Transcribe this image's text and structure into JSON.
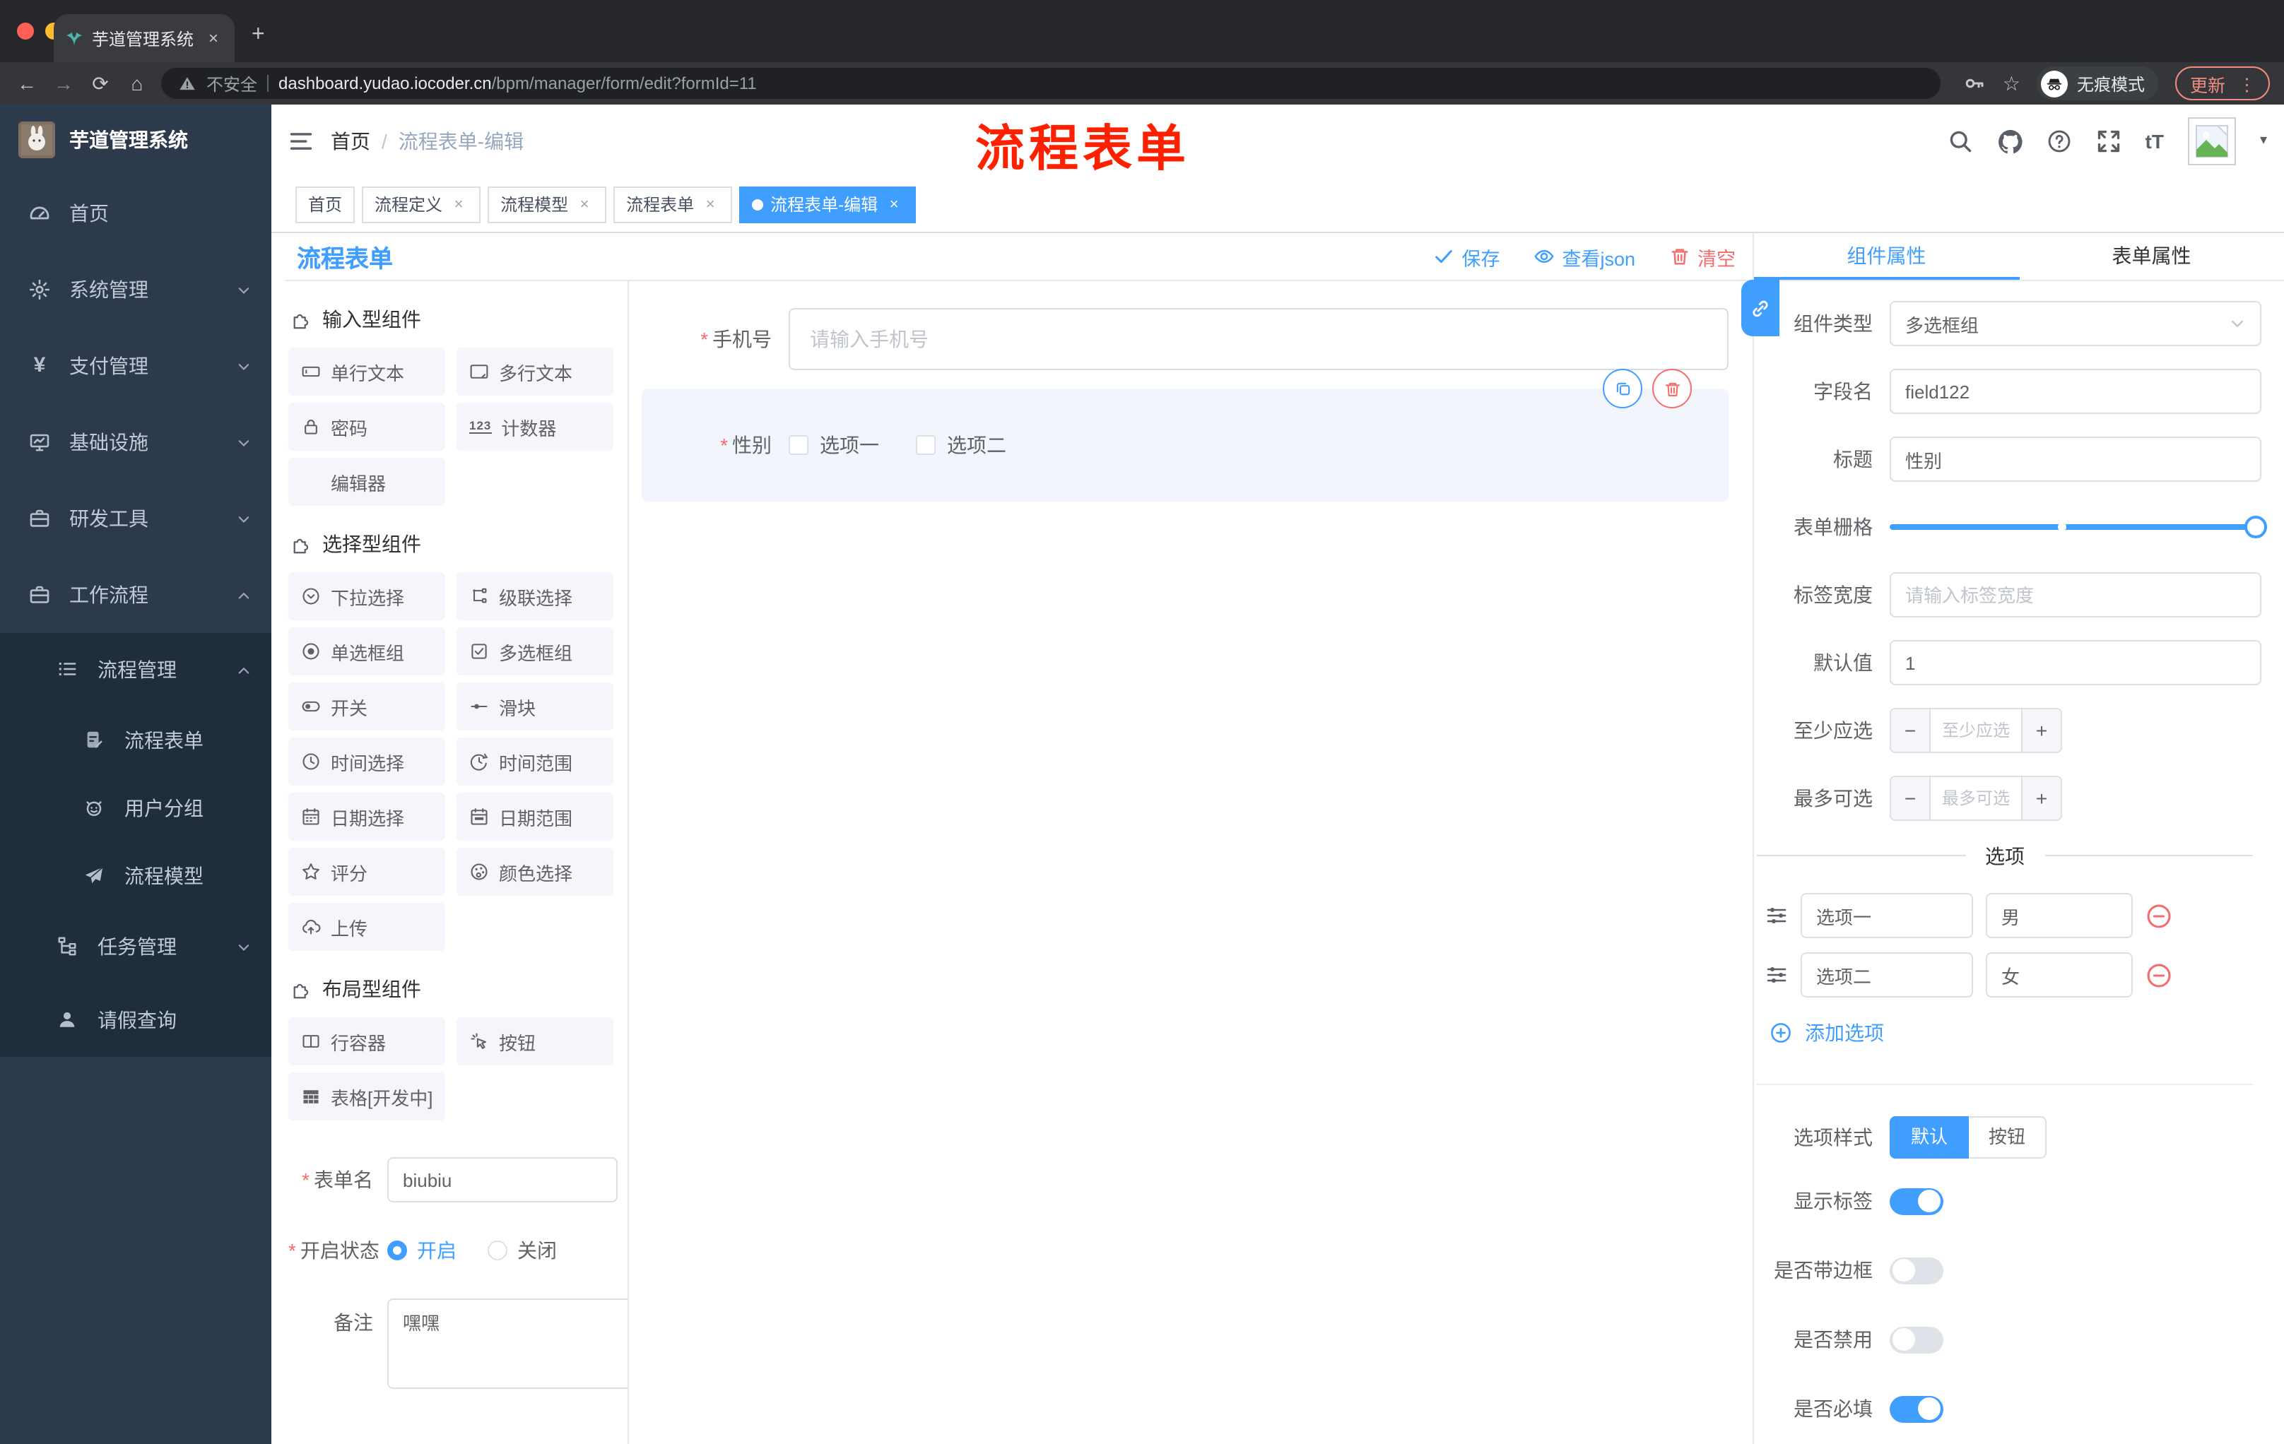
{
  "glyphs": {
    "close": "×",
    "plus": "+",
    "minus": "−",
    "dots": "⋮",
    "caret_down": "▾",
    "back": "←",
    "forward": "→",
    "reload": "⟳",
    "home": "⌂",
    "star": "☆",
    "yen": "¥",
    "counter": "123",
    "font_size": "tT"
  },
  "theme": {
    "accent": "#409eff",
    "danger": "#f56c6c",
    "annotation_red": "#ff2000",
    "sidebar_bg": "#2d3a4b",
    "submenu_bg": "#1f2d3d"
  },
  "browser": {
    "tab_title": "芋道管理系统",
    "security": "不安全",
    "url_host": "dashboard.yudao.iocoder.cn",
    "url_path": "/bpm/manager/form/edit?formId=11",
    "incognito": "无痕模式",
    "update": "更新"
  },
  "annotation": "流程表单",
  "sidebar": {
    "title": "芋道管理系统",
    "items": [
      {
        "label": "首页"
      },
      {
        "label": "系统管理"
      },
      {
        "label": "支付管理"
      },
      {
        "label": "基础设施"
      },
      {
        "label": "研发工具"
      },
      {
        "label": "工作流程"
      },
      {
        "label": "流程管理"
      },
      {
        "label": "流程表单"
      },
      {
        "label": "用户分组"
      },
      {
        "label": "流程模型"
      },
      {
        "label": "任务管理"
      },
      {
        "label": "请假查询"
      }
    ]
  },
  "header": {
    "breadcrumb_home": "首页",
    "breadcrumb_sep": "/",
    "breadcrumb_current": "流程表单-编辑"
  },
  "tags": [
    {
      "label": "首页"
    },
    {
      "label": "流程定义"
    },
    {
      "label": "流程模型"
    },
    {
      "label": "流程表单"
    },
    {
      "label": "流程表单-编辑"
    }
  ],
  "designer": {
    "panel_title": "流程表单",
    "toolbar": {
      "save": "保存",
      "view_json": "查看json",
      "clear": "清空"
    },
    "sections": [
      {
        "title": "输入型组件",
        "items": [
          {
            "label": "单行文本"
          },
          {
            "label": "多行文本"
          },
          {
            "label": "密码"
          },
          {
            "label": "计数器"
          },
          {
            "label": "编辑器"
          }
        ]
      },
      {
        "title": "选择型组件",
        "items": [
          {
            "label": "下拉选择"
          },
          {
            "label": "级联选择"
          },
          {
            "label": "单选框组"
          },
          {
            "label": "多选框组"
          },
          {
            "label": "开关"
          },
          {
            "label": "滑块"
          },
          {
            "label": "时间选择"
          },
          {
            "label": "时间范围"
          },
          {
            "label": "日期选择"
          },
          {
            "label": "日期范围"
          },
          {
            "label": "评分"
          },
          {
            "label": "颜色选择"
          },
          {
            "label": "上传"
          }
        ]
      },
      {
        "title": "布局型组件",
        "items": [
          {
            "label": "行容器"
          },
          {
            "label": "按钮"
          },
          {
            "label": "表格[开发中]"
          }
        ]
      }
    ],
    "meta": {
      "name_label": "表单名",
      "name_value": "biubiu",
      "status_label": "开启状态",
      "on": "开启",
      "off": "关闭",
      "remark_label": "备注",
      "remark_value": "嘿嘿"
    },
    "canvas": {
      "phone_label": "手机号",
      "phone_placeholder": "请输入手机号",
      "gender_label": "性别",
      "opt1": "选项一",
      "opt2": "选项二"
    }
  },
  "props": {
    "tab_component": "组件属性",
    "tab_form": "表单属性",
    "type_label": "组件类型",
    "type_value": "多选框组",
    "field_label": "字段名",
    "field_value": "field122",
    "title_label": "标题",
    "title_value": "性别",
    "grid_label": "表单栅格",
    "width_label": "标签宽度",
    "width_placeholder": "请输入标签宽度",
    "default_label": "默认值",
    "default_value": "1",
    "min_label": "至少应选",
    "min_placeholder": "至少应选",
    "max_label": "最多可选",
    "max_placeholder": "最多可选",
    "divider_options": "选项",
    "options": [
      {
        "label": "选项一",
        "value": "男"
      },
      {
        "label": "选项二",
        "value": "女"
      }
    ],
    "add_option": "添加选项",
    "style_label": "选项样式",
    "style_default": "默认",
    "style_button": "按钮",
    "toggle_show": "显示标签",
    "toggle_border": "是否带边框",
    "toggle_disabled": "是否禁用",
    "toggle_required": "是否必填"
  }
}
